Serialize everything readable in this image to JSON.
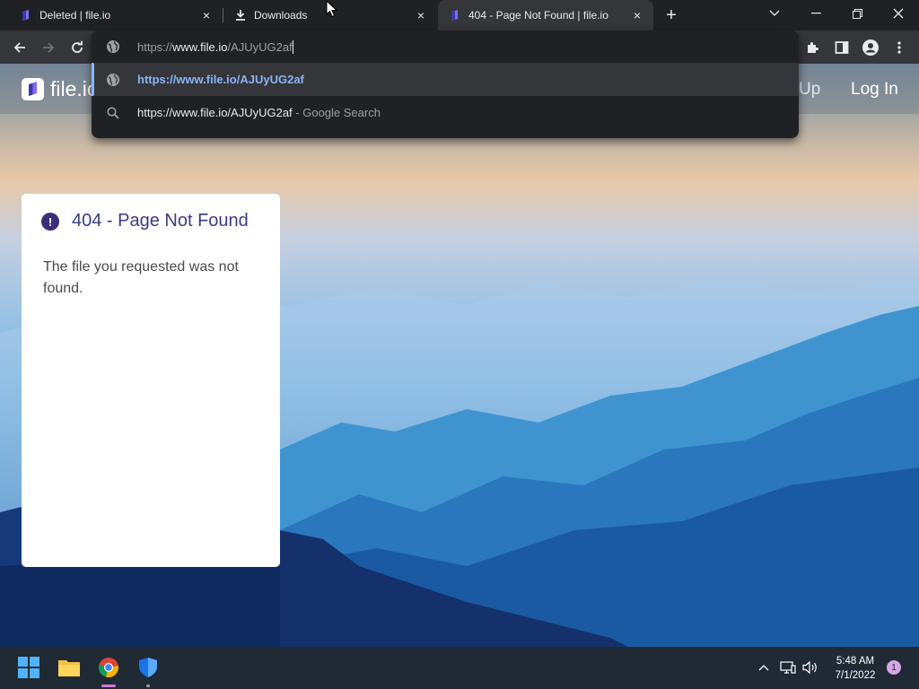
{
  "browser": {
    "tabs": [
      {
        "title": "Deleted | file.io",
        "close": "×"
      },
      {
        "title": "Downloads",
        "close": "×"
      },
      {
        "title": "404 - Page Not Found | file.io",
        "close": "×",
        "active": true
      }
    ],
    "new_tab": "+",
    "omnibox": {
      "scheme": "https://",
      "host": "www.file.io",
      "path": "/AJUyUG2af"
    },
    "suggestions": [
      {
        "text": "https://www.file.io/AJUyUG2af",
        "icon": "globe-icon",
        "selected": true
      },
      {
        "text": "https://www.file.io/AJUyUG2af",
        "suffix": " - Google Search",
        "icon": "search-icon"
      }
    ]
  },
  "site": {
    "logo": "file.io",
    "nav_signup": "Up",
    "nav_login": "Log In"
  },
  "error_card": {
    "title": "404 - Page Not Found",
    "message": "The file you requested was not found."
  },
  "taskbar": {
    "time": "5:48 AM",
    "date": "7/1/2022",
    "notifications": "1"
  },
  "colors": {
    "accent_link": "#8ab4f8",
    "brand_purple": "#3b2f7c"
  }
}
